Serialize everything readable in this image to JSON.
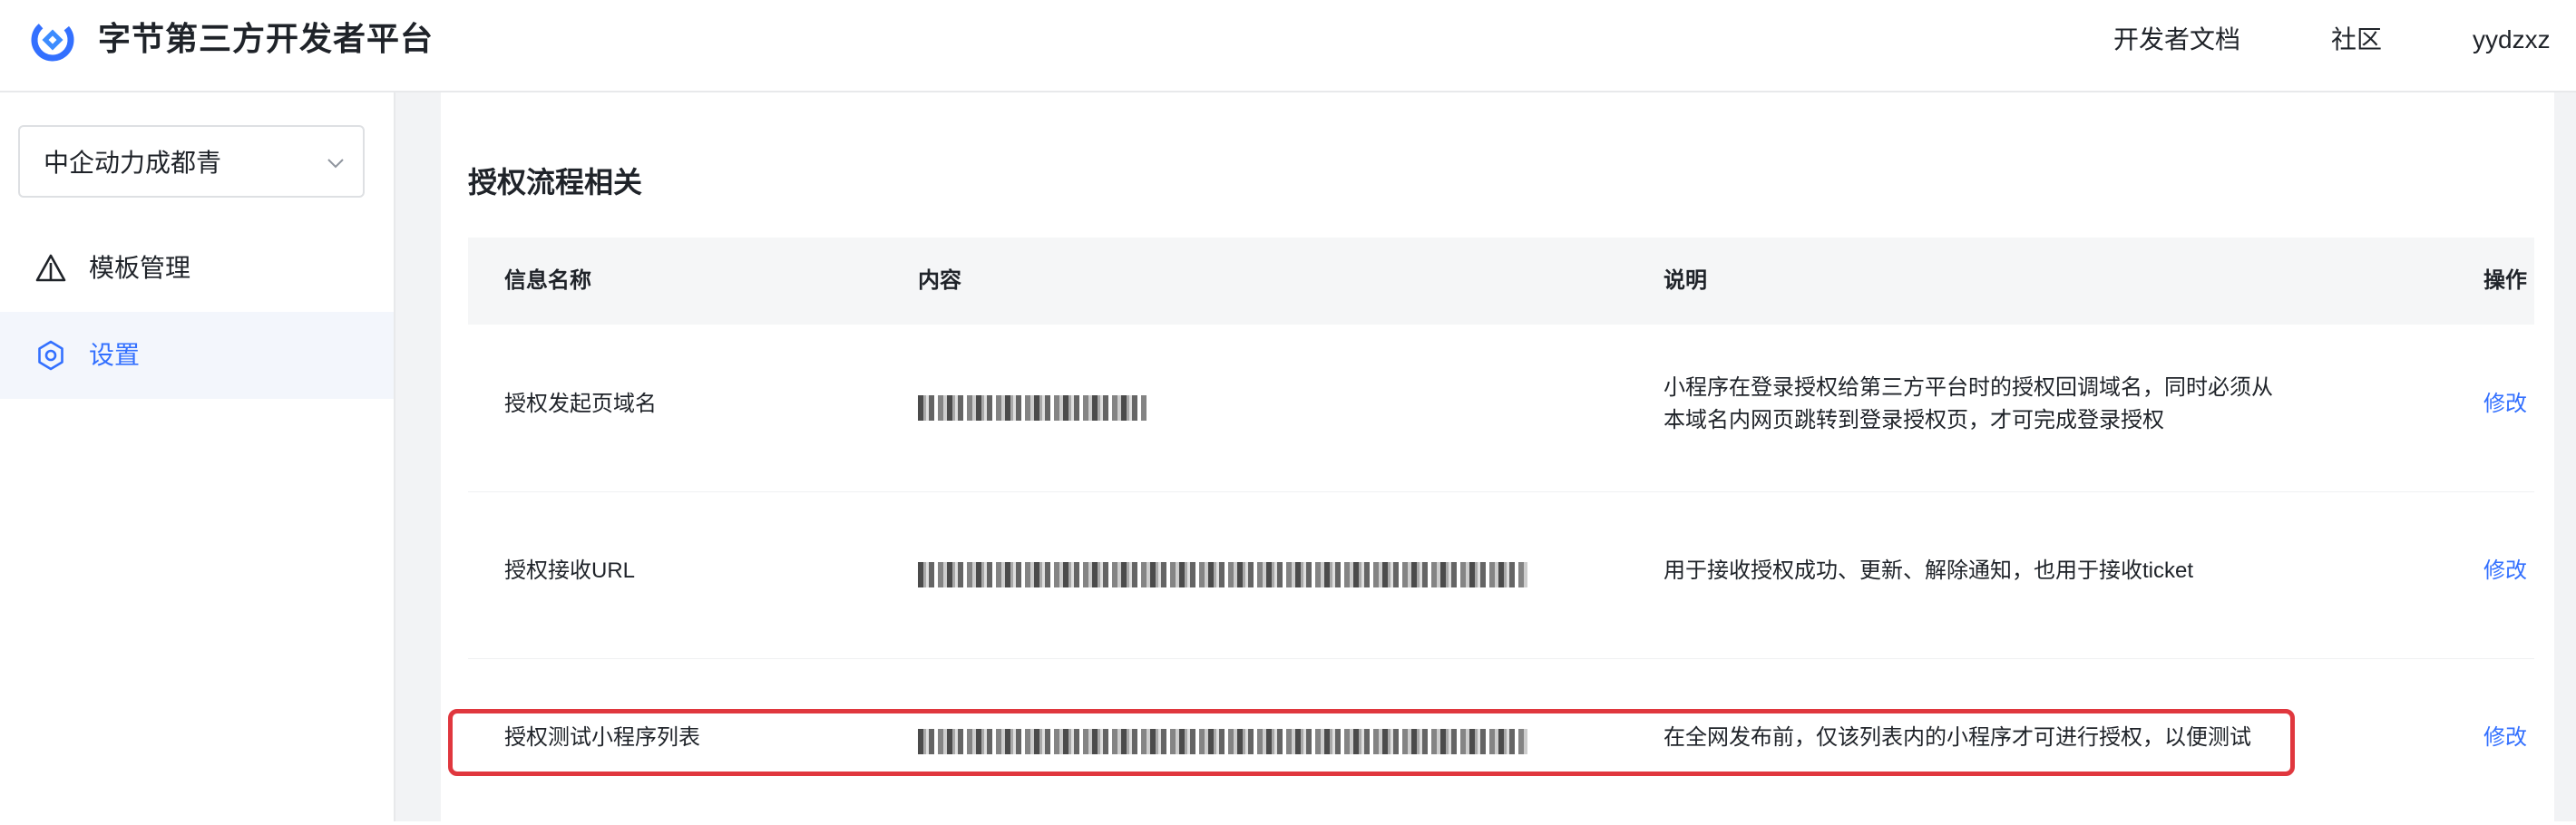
{
  "header": {
    "brand_title": "字节第三方开发者平台",
    "nav_docs": "开发者文档",
    "nav_community": "社区",
    "user_name": "yydzxz"
  },
  "sidebar": {
    "org_select_value": "中企动力成都青",
    "items": [
      {
        "label": "模板管理",
        "icon": "triangle-warning-icon",
        "active": false
      },
      {
        "label": "设置",
        "icon": "gear-icon",
        "active": true
      }
    ]
  },
  "main": {
    "section_title": "授权流程相关",
    "table": {
      "headers": {
        "name": "信息名称",
        "content": "内容",
        "desc": "说明",
        "action": "操作"
      },
      "rows": [
        {
          "name": "授权发起页域名",
          "content_redacted": true,
          "desc": "小程序在登录授权给第三方平台时的授权回调域名，同时必须从本域名内网页跳转到登录授权页，才可完成登录授权",
          "action": "修改"
        },
        {
          "name": "授权接收URL",
          "content_redacted": true,
          "desc": "用于接收授权成功、更新、解除通知，也用于接收ticket",
          "action": "修改"
        },
        {
          "name": "授权测试小程序列表",
          "content_redacted": true,
          "desc": "在全网发布前，仅该列表内的小程序才可进行授权，以便测试",
          "action": "修改",
          "highlighted": true
        }
      ]
    }
  },
  "colors": {
    "accent": "#3370ff",
    "highlight_border": "#e0373e",
    "table_header_bg": "#f5f6f7",
    "sidebar_active_bg": "#f3f6fc",
    "gutter_bg": "#f2f3f5"
  }
}
